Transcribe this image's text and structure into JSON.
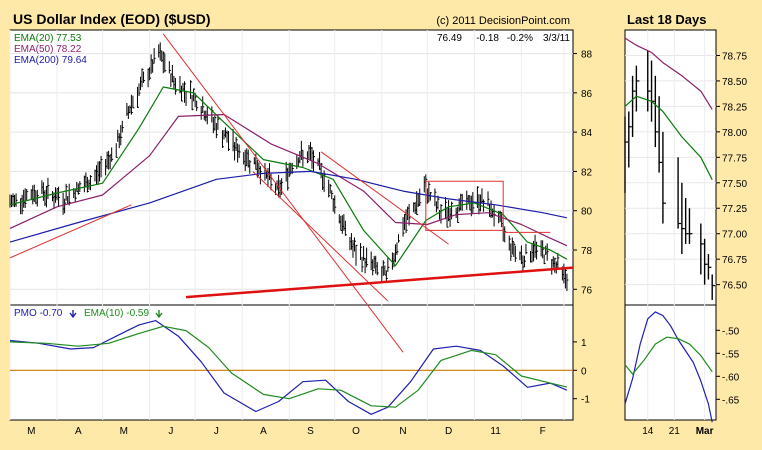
{
  "colors": {
    "frame_bg": "#FFE9A8",
    "plot_bg": "#FFFFFF",
    "ema20": "#0A7A0A",
    "ema50": "#8B1F6A",
    "ema200": "#1C1CAA",
    "trendline_thin": "#E03030",
    "trendline_thick": "#E01010",
    "pmo": "#2020B0",
    "pmo_signal": "#1E8B1E",
    "zero_line": "#C87800",
    "price_bars": "#000000"
  },
  "chart_data": [
    {
      "type": "line",
      "title": "US Dollar Index (EOD) ($USD)",
      "copyright": "(c) 2011 DecisionPoint.com",
      "last_quote": {
        "close": "76.49",
        "change": "-0.18",
        "pct_change": "-0.2%",
        "date": "3/3/11"
      },
      "ylim": [
        75.2,
        89.2
      ],
      "y_ticks": [
        "76",
        "78",
        "80",
        "82",
        "84",
        "86",
        "88"
      ],
      "x_ticks": [
        "M",
        "A",
        "M",
        "J",
        "J",
        "A",
        "S",
        "O",
        "N",
        "D",
        "11",
        "F",
        "M"
      ],
      "x_range": [
        "2010-03-01",
        "2011-03-07"
      ],
      "legend_placement": "top-left",
      "legend": [
        {
          "label": "EMA(20)",
          "value": "77.53",
          "key": "ema20"
        },
        {
          "label": "EMA(50)",
          "value": "78.22",
          "key": "ema50"
        },
        {
          "label": "EMA(200)",
          "value": "79.64",
          "key": "ema200"
        }
      ],
      "price_anchors": {
        "x": [
          "2010-03-01",
          "2010-03-20",
          "2010-04-05",
          "2010-04-25",
          "2010-05-10",
          "2010-05-20",
          "2010-05-30",
          "2010-06-07",
          "2010-06-18",
          "2010-06-30",
          "2010-07-15",
          "2010-07-30",
          "2010-08-10",
          "2010-08-25",
          "2010-09-05",
          "2010-09-15",
          "2010-09-25",
          "2010-10-05",
          "2010-10-15",
          "2010-10-25",
          "2010-11-04",
          "2010-11-15",
          "2010-11-30",
          "2010-12-10",
          "2010-12-25",
          "2011-01-05",
          "2011-01-15",
          "2011-01-25",
          "2011-02-02",
          "2011-02-10",
          "2011-02-20",
          "2011-03-03"
        ],
        "y": [
          80.4,
          81.0,
          80.6,
          81.6,
          83.2,
          85.5,
          86.8,
          88.0,
          86.5,
          85.8,
          84.3,
          83.0,
          82.4,
          81.0,
          82.7,
          82.8,
          81.6,
          79.5,
          77.8,
          77.3,
          76.6,
          79.2,
          81.2,
          79.8,
          80.3,
          80.6,
          79.8,
          78.2,
          77.6,
          78.1,
          77.6,
          76.5
        ]
      },
      "series": [
        {
          "name": "EMA(20)",
          "key": "ema20",
          "x": [
            "2010-03-01",
            "2010-04-01",
            "2010-05-01",
            "2010-05-25",
            "2010-06-10",
            "2010-06-30",
            "2010-07-20",
            "2010-08-15",
            "2010-09-10",
            "2010-09-30",
            "2010-10-20",
            "2010-11-10",
            "2010-11-30",
            "2010-12-15",
            "2011-01-01",
            "2011-01-20",
            "2011-02-05",
            "2011-02-20",
            "2011-03-03"
          ],
          "y": [
            80.3,
            80.9,
            81.4,
            84.2,
            86.3,
            86.0,
            84.5,
            82.6,
            82.2,
            81.6,
            79.0,
            77.2,
            79.5,
            80.2,
            80.4,
            79.8,
            78.4,
            78.0,
            77.53
          ]
        },
        {
          "name": "EMA(50)",
          "key": "ema50",
          "x": [
            "2010-03-01",
            "2010-04-01",
            "2010-05-01",
            "2010-06-01",
            "2010-06-20",
            "2010-07-20",
            "2010-08-20",
            "2010-09-20",
            "2010-10-20",
            "2010-11-10",
            "2010-12-01",
            "2010-12-20",
            "2011-01-10",
            "2011-02-01",
            "2011-02-20",
            "2011-03-03"
          ],
          "y": [
            79.1,
            80.2,
            80.8,
            82.8,
            84.8,
            84.9,
            83.4,
            82.4,
            81.0,
            79.4,
            79.3,
            79.8,
            79.9,
            79.3,
            78.6,
            78.22
          ]
        },
        {
          "name": "EMA(200)",
          "key": "ema200",
          "x": [
            "2010-03-01",
            "2010-04-15",
            "2010-06-01",
            "2010-07-15",
            "2010-08-15",
            "2010-09-15",
            "2010-10-15",
            "2010-11-15",
            "2010-12-15",
            "2011-01-15",
            "2011-02-15",
            "2011-03-03"
          ],
          "y": [
            78.4,
            79.4,
            80.4,
            81.6,
            81.9,
            82.0,
            81.6,
            81.0,
            80.6,
            80.3,
            79.9,
            79.64
          ]
        }
      ],
      "annotations": [
        {
          "kind": "thin",
          "from": [
            "2010-06-10",
            89.0
          ],
          "to": [
            "2010-11-15",
            72.8
          ]
        },
        {
          "kind": "thin",
          "from": [
            "2010-08-08",
            82.0
          ],
          "to": [
            "2010-11-05",
            75.4
          ]
        },
        {
          "kind": "thin",
          "from": [
            "2010-03-01",
            77.6
          ],
          "to": [
            "2010-05-20",
            80.3
          ]
        },
        {
          "kind": "thin",
          "from": [
            "2010-09-22",
            83.0
          ],
          "to": [
            "2010-12-15",
            78.3
          ]
        },
        {
          "kind": "rect",
          "from": [
            "2010-11-30",
            81.5
          ],
          "to": [
            "2011-01-20",
            79.0
          ]
        },
        {
          "kind": "rect",
          "from": [
            "2011-01-20",
            78.9
          ],
          "to": [
            "2011-02-20",
            78.9
          ]
        },
        {
          "kind": "thick",
          "from": [
            "2010-06-25",
            75.6
          ],
          "to": [
            "2011-03-07",
            77.1
          ]
        }
      ]
    },
    {
      "type": "line",
      "ylim": [
        -1.75,
        2.3
      ],
      "y_ticks": [
        "1",
        "0",
        "-1"
      ],
      "zero_line": 0,
      "legend": [
        {
          "label": "PMO",
          "value": "-0.70",
          "arrow": "down",
          "key": "pmo"
        },
        {
          "label": "EMA(10)",
          "value": "-0.59",
          "arrow": "down",
          "key": "pmo_signal"
        }
      ],
      "series": [
        {
          "name": "PMO",
          "key": "pmo",
          "x": [
            "2010-03-01",
            "2010-03-20",
            "2010-04-10",
            "2010-04-25",
            "2010-05-10",
            "2010-05-25",
            "2010-06-05",
            "2010-06-20",
            "2010-07-05",
            "2010-07-20",
            "2010-08-10",
            "2010-08-25",
            "2010-09-10",
            "2010-09-25",
            "2010-10-10",
            "2010-10-25",
            "2010-11-05",
            "2010-11-20",
            "2010-12-05",
            "2010-12-20",
            "2011-01-05",
            "2011-01-20",
            "2011-02-05",
            "2011-02-20",
            "2011-03-03"
          ],
          "y": [
            1.05,
            0.95,
            0.75,
            0.8,
            1.2,
            1.6,
            1.75,
            1.2,
            0.3,
            -0.8,
            -1.45,
            -1.1,
            -0.4,
            -0.35,
            -1.1,
            -1.55,
            -1.3,
            -0.4,
            0.75,
            0.85,
            0.7,
            0.15,
            -0.6,
            -0.45,
            -0.7
          ]
        },
        {
          "name": "EMA(10)",
          "key": "pmo_signal",
          "x": [
            "2010-03-01",
            "2010-03-25",
            "2010-04-15",
            "2010-05-05",
            "2010-05-25",
            "2010-06-10",
            "2010-06-25",
            "2010-07-10",
            "2010-07-25",
            "2010-08-15",
            "2010-09-01",
            "2010-09-20",
            "2010-10-05",
            "2010-10-25",
            "2010-11-10",
            "2010-11-25",
            "2010-12-10",
            "2010-12-30",
            "2011-01-15",
            "2011-02-01",
            "2011-02-20",
            "2011-03-03"
          ],
          "y": [
            1.0,
            0.95,
            0.85,
            0.95,
            1.3,
            1.55,
            1.4,
            0.8,
            -0.1,
            -0.85,
            -1.0,
            -0.65,
            -0.7,
            -1.25,
            -1.3,
            -0.7,
            0.35,
            0.7,
            0.55,
            -0.2,
            -0.45,
            -0.59
          ]
        }
      ]
    },
    {
      "type": "line",
      "title": "Last 18 Days",
      "ylim": [
        76.3,
        79.0
      ],
      "y_ticks": [
        "76.50",
        "76.75",
        "77.00",
        "77.25",
        "77.50",
        "77.75",
        "78.00",
        "78.25",
        "78.50",
        "78.75"
      ],
      "x_ticks": [
        "14",
        "21",
        "Mar"
      ],
      "x_range": [
        "2011-02-08",
        "2011-03-04"
      ],
      "bars": {
        "x": [
          "2011-02-08",
          "2011-02-09",
          "2011-02-10",
          "2011-02-11",
          "2011-02-14",
          "2011-02-15",
          "2011-02-16",
          "2011-02-17",
          "2011-02-18",
          "2011-02-22",
          "2011-02-23",
          "2011-02-24",
          "2011-02-25",
          "2011-02-28",
          "2011-03-01",
          "2011-03-02",
          "2011-03-03"
        ],
        "high": [
          78.15,
          78.2,
          78.55,
          78.65,
          78.8,
          78.7,
          78.55,
          78.35,
          78.0,
          77.75,
          77.5,
          77.35,
          77.25,
          77.1,
          76.95,
          76.8,
          76.6
        ],
        "low": [
          77.4,
          77.65,
          77.95,
          78.2,
          78.2,
          78.1,
          77.85,
          77.6,
          77.1,
          77.05,
          76.8,
          76.9,
          76.9,
          76.6,
          76.5,
          76.55,
          76.35
        ],
        "close": [
          77.9,
          78.05,
          78.4,
          78.5,
          78.4,
          78.3,
          78.0,
          77.7,
          77.3,
          77.1,
          77.05,
          77.0,
          77.0,
          76.9,
          76.7,
          76.67,
          76.49
        ]
      },
      "series": [
        {
          "name": "EMA(20)",
          "key": "ema20",
          "x": [
            "2011-02-08",
            "2011-02-11",
            "2011-02-15",
            "2011-02-18",
            "2011-02-23",
            "2011-02-28",
            "2011-03-03"
          ],
          "y": [
            78.25,
            78.35,
            78.3,
            78.2,
            77.95,
            77.75,
            77.53
          ]
        },
        {
          "name": "EMA(50)",
          "key": "ema50",
          "x": [
            "2011-02-08",
            "2011-02-11",
            "2011-02-15",
            "2011-02-18",
            "2011-02-23",
            "2011-02-28",
            "2011-03-03"
          ],
          "y": [
            78.92,
            78.85,
            78.78,
            78.68,
            78.55,
            78.4,
            78.22
          ]
        }
      ]
    },
    {
      "type": "line",
      "ylim": [
        -0.695,
        -0.445
      ],
      "y_ticks": [
        "-.50",
        "-.55",
        "-.60",
        "-.65"
      ],
      "series": [
        {
          "name": "PMO",
          "key": "pmo",
          "x": [
            "2011-02-08",
            "2011-02-10",
            "2011-02-12",
            "2011-02-14",
            "2011-02-16",
            "2011-02-18",
            "2011-02-20",
            "2011-02-22",
            "2011-02-24",
            "2011-02-26",
            "2011-02-28",
            "2011-03-02",
            "2011-03-03"
          ],
          "y": [
            -0.66,
            -0.605,
            -0.53,
            -0.475,
            -0.46,
            -0.468,
            -0.49,
            -0.52,
            -0.545,
            -0.57,
            -0.61,
            -0.66,
            -0.7
          ]
        },
        {
          "name": "EMA(10)",
          "key": "pmo_signal",
          "x": [
            "2011-02-08",
            "2011-02-10",
            "2011-02-13",
            "2011-02-16",
            "2011-02-19",
            "2011-02-22",
            "2011-02-25",
            "2011-02-28",
            "2011-03-03"
          ],
          "y": [
            -0.575,
            -0.595,
            -0.565,
            -0.53,
            -0.515,
            -0.518,
            -0.53,
            -0.555,
            -0.59
          ]
        }
      ]
    }
  ]
}
